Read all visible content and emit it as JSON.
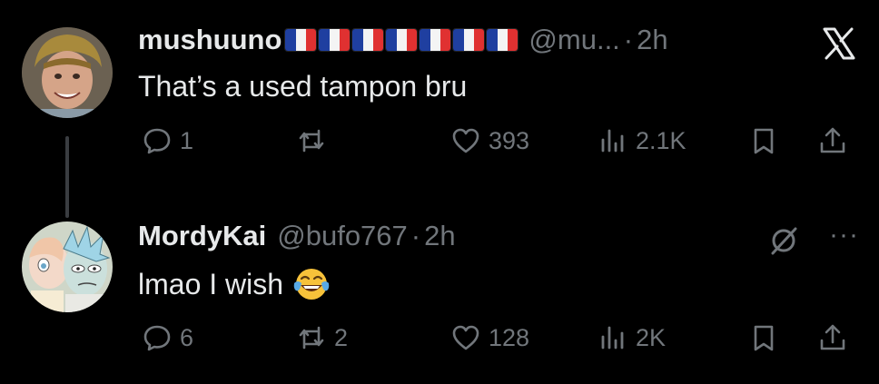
{
  "tweets": [
    {
      "name": "mushuuno",
      "flag_count": 7,
      "flag_colors": [
        "#1f3fa0",
        "#f4f4f4",
        "#e03131"
      ],
      "handle": "@mu...",
      "separator": "·",
      "time": "2h",
      "text": "That’s a used tampon bru",
      "replies": "1",
      "reposts": "",
      "likes": "393",
      "views": "2.1K",
      "top_right_icon": "x-logo-icon"
    },
    {
      "name": "MordyKai",
      "handle": "@bufo767",
      "separator": "·",
      "time": "2h",
      "text": "lmao I wish",
      "emoji": "face-with-tears-of-joy",
      "replies": "6",
      "reposts": "2",
      "likes": "128",
      "views": "2K",
      "top_right_icons": [
        "grok-icon",
        "more-icon"
      ],
      "more_label": "···"
    }
  ],
  "colors": {
    "background": "#000000",
    "text": "#e7e9ea",
    "muted": "#71767b",
    "thread_line": "#3a3d41"
  }
}
